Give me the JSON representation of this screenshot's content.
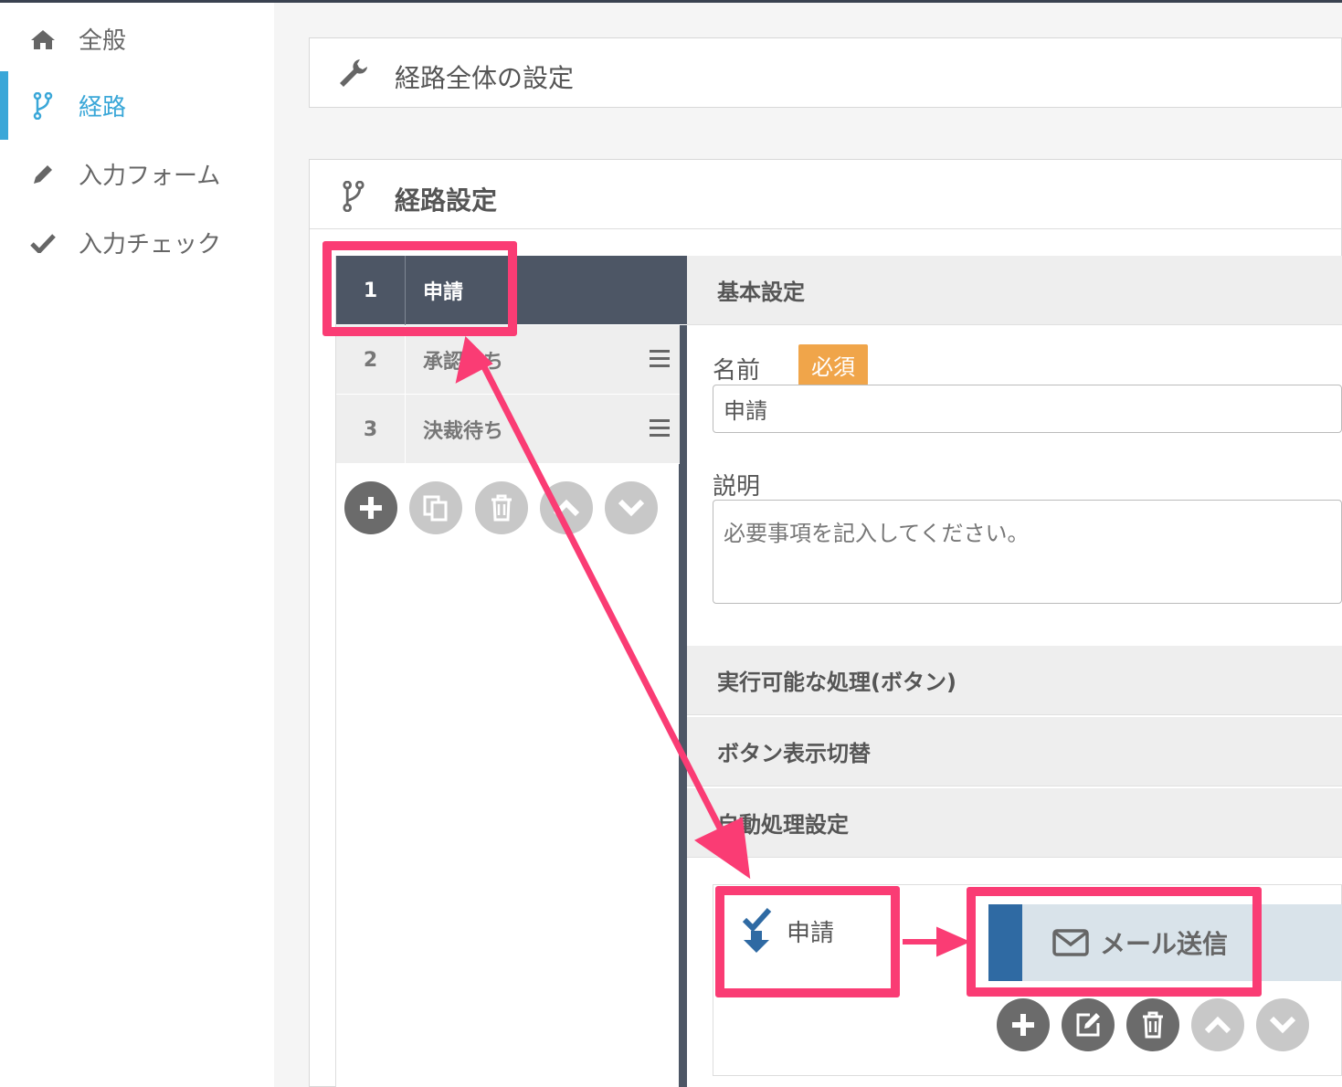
{
  "sidebar": {
    "items": [
      {
        "label": "全般",
        "icon": "home-icon",
        "active": false
      },
      {
        "label": "経路",
        "icon": "branch-icon",
        "active": true
      },
      {
        "label": "入力フォーム",
        "icon": "pencil-icon",
        "active": false
      },
      {
        "label": "入力チェック",
        "icon": "check-icon",
        "active": false
      }
    ]
  },
  "route_overall": {
    "title": "経路全体の設定"
  },
  "route_settings": {
    "title": "経路設定",
    "steps": [
      {
        "num": "1",
        "label": "申請"
      },
      {
        "num": "2",
        "label": "承認待ち"
      },
      {
        "num": "3",
        "label": "決裁待ち"
      }
    ]
  },
  "basic": {
    "heading": "基本設定",
    "name_label": "名前",
    "required_badge": "必須",
    "name_value": "申請",
    "desc_label": "説明",
    "desc_placeholder": "必要事項を記入してください。"
  },
  "sections": {
    "actions": "実行可能な処理(ボタン)",
    "button_toggle": "ボタン表示切替",
    "auto_process": "自動処理設定"
  },
  "auto": {
    "trigger_label": "申請",
    "action_label": "メール送信"
  },
  "colors": {
    "accent": "#3aa7d8",
    "step_active": "#4d5665",
    "required": "#f0a54a",
    "mail_stripe": "#2f6aa3",
    "annotation": "#fa3c74"
  }
}
